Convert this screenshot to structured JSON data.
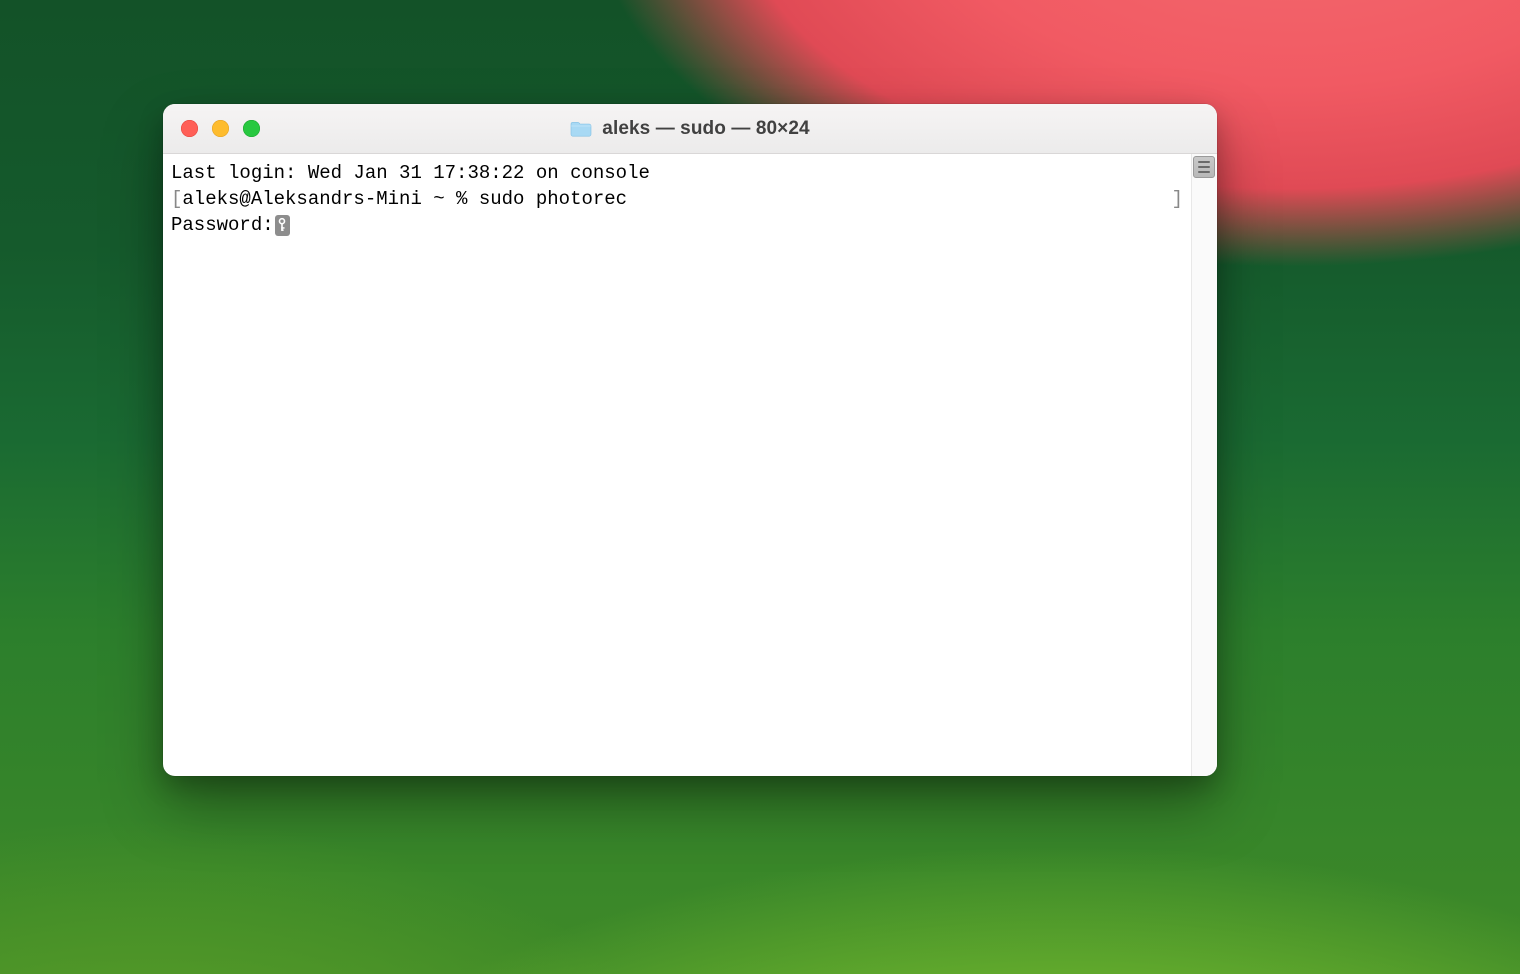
{
  "window": {
    "title": "aleks — sudo — 80×24"
  },
  "terminal": {
    "last_login_line": "Last login: Wed Jan 31 17:38:22 on console",
    "prompt_left_bracket": "[",
    "prompt_text": "aleks@Aleksandrs-Mini ~ % sudo photorec",
    "prompt_right_bracket": "]",
    "password_label": "Password:"
  },
  "icons": {
    "folder": "folder-icon",
    "key": "key-icon"
  },
  "colors": {
    "close": "#ff5f57",
    "minimize": "#febc2e",
    "maximize": "#28c840"
  }
}
